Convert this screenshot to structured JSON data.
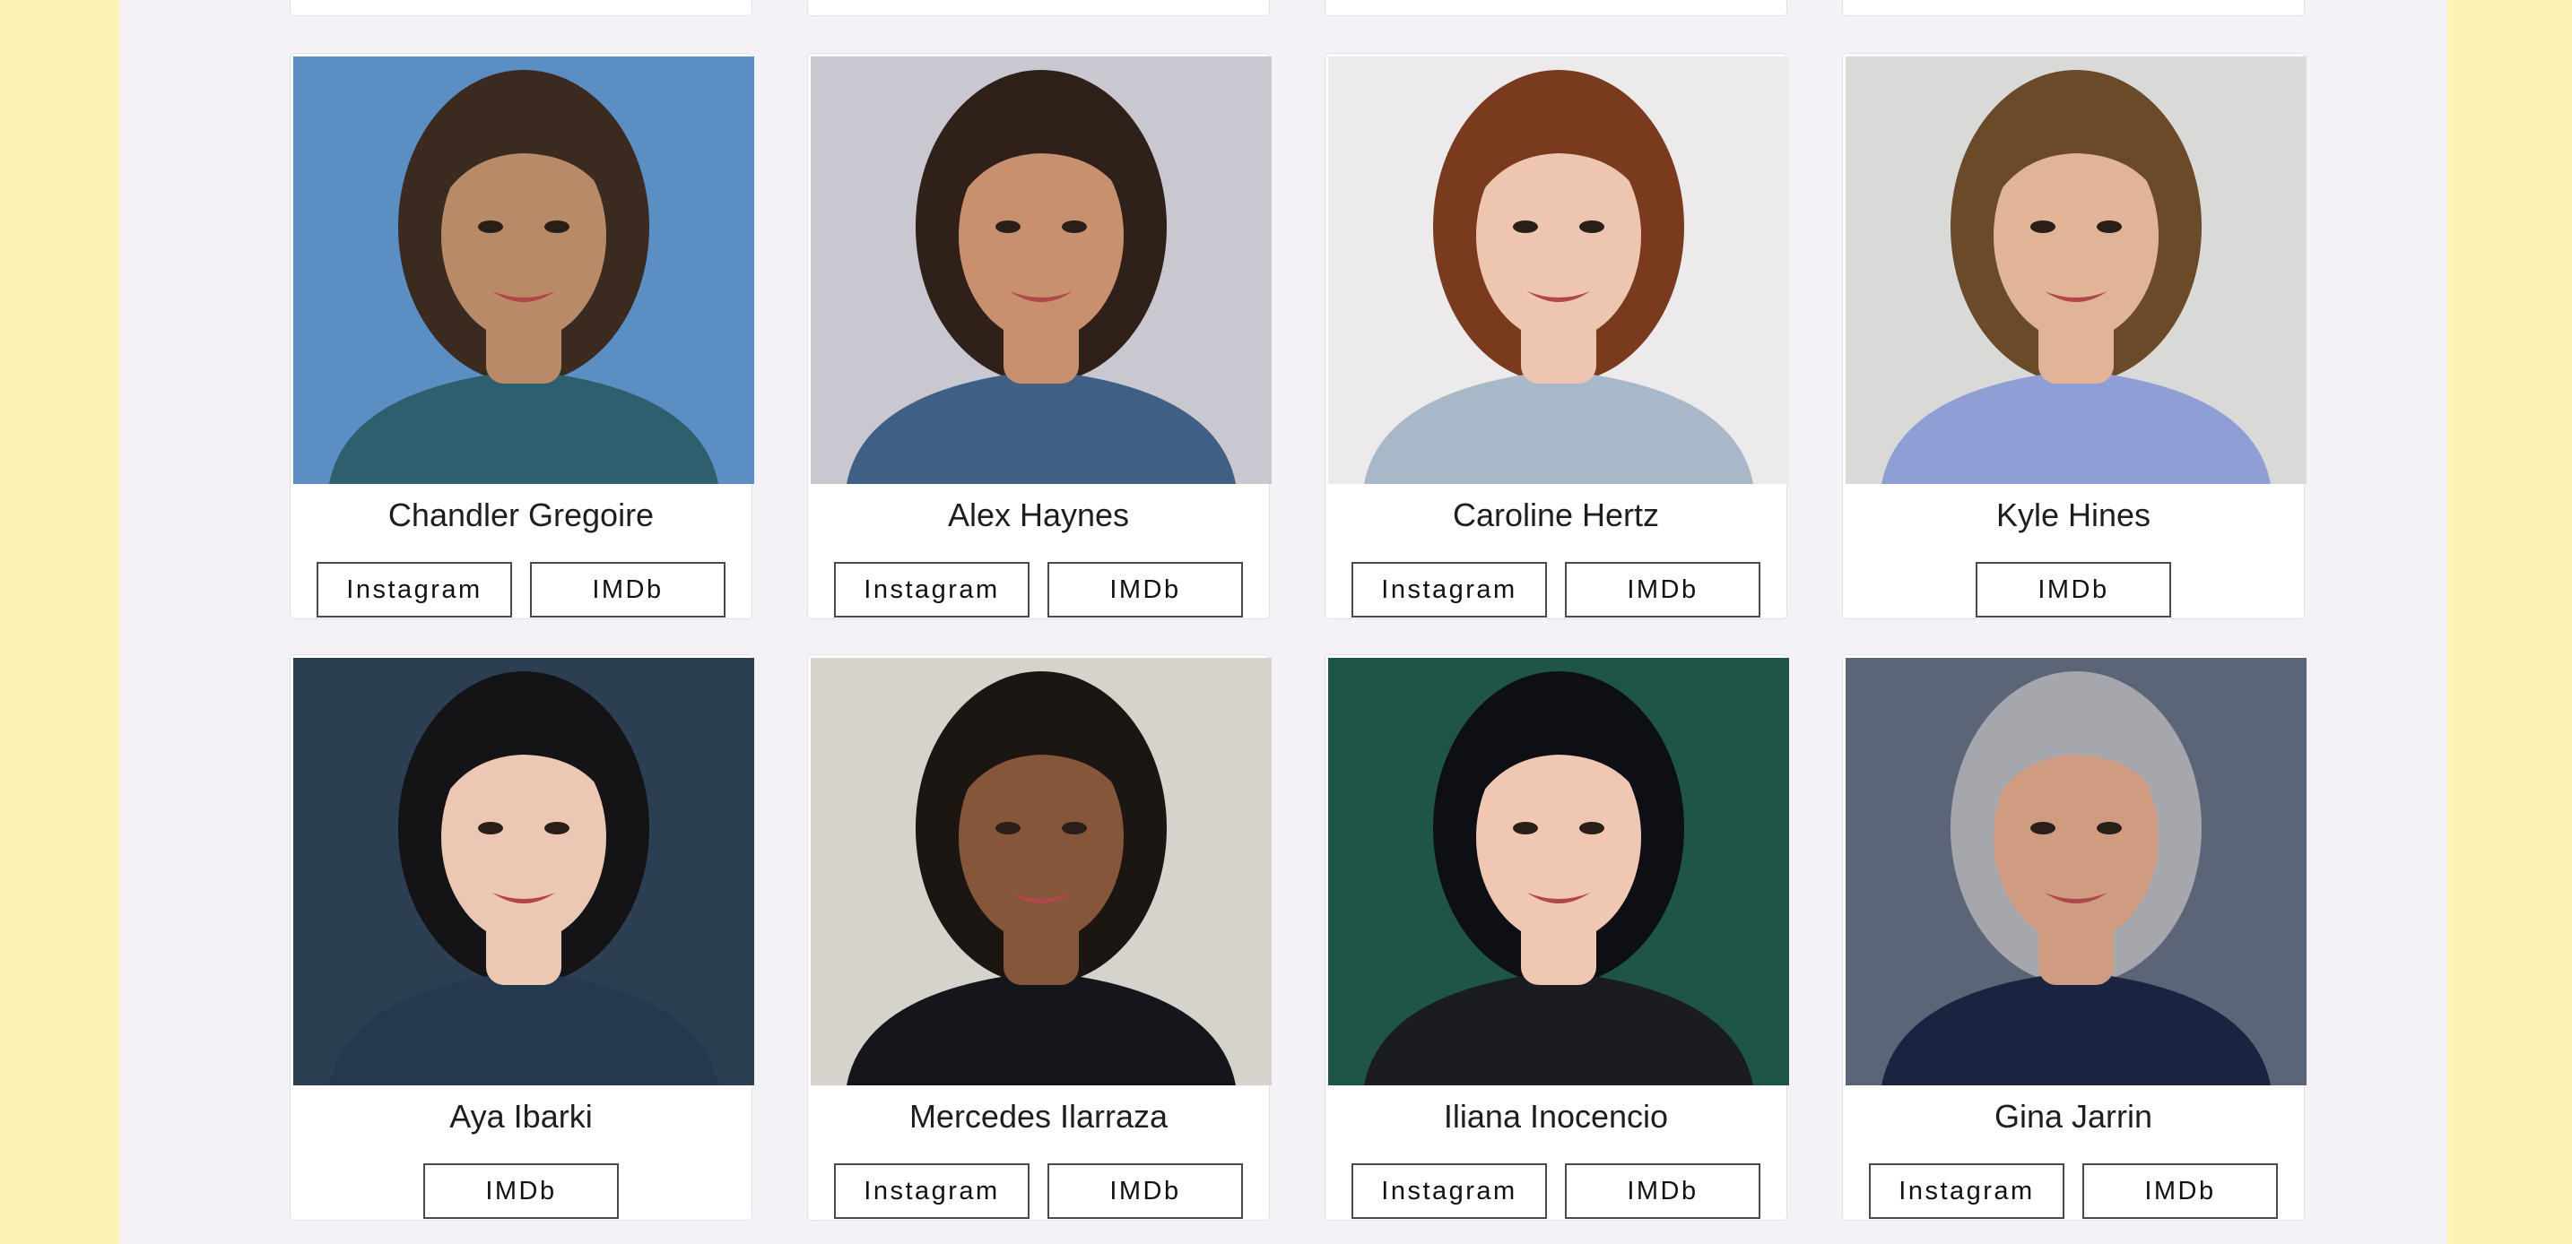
{
  "actors": [
    {
      "name": "Chandler Gregoire",
      "buttons": [
        "Instagram",
        "IMDb"
      ],
      "bg": "#5b8fc4",
      "hair": "#3a2a20",
      "skin": "#b98a68",
      "shirt": "#2e5f6e"
    },
    {
      "name": "Alex Haynes",
      "buttons": [
        "Instagram",
        "IMDb"
      ],
      "bg": "#c9c7d0",
      "hair": "#2f2119",
      "skin": "#c8906f",
      "shirt": "#3f5f85"
    },
    {
      "name": "Caroline Hertz",
      "buttons": [
        "Instagram",
        "IMDb"
      ],
      "bg": "#eceaea",
      "hair": "#7a3a1e",
      "skin": "#eec5b1",
      "shirt": "#a9b8c8"
    },
    {
      "name": "Kyle Hines",
      "buttons": [
        "IMDb"
      ],
      "bg": "#d9d9d8",
      "hair": "#6b4a2a",
      "skin": "#e2b497",
      "shirt": "#8f9fd6"
    },
    {
      "name": "Aya Ibarki",
      "buttons": [
        "IMDb"
      ],
      "bg": "#2c3f52",
      "hair": "#141416",
      "skin": "#ecc7b3",
      "shirt": "#25384f"
    },
    {
      "name": "Mercedes Ilarraza",
      "buttons": [
        "Instagram",
        "IMDb"
      ],
      "bg": "#d6d2cc",
      "hair": "#1c1612",
      "skin": "#86563b",
      "shirt": "#15151c"
    },
    {
      "name": "Iliana Inocencio",
      "buttons": [
        "Instagram",
        "IMDb"
      ],
      "bg": "#1f5448",
      "hair": "#0e0f14",
      "skin": "#f0c7b3",
      "shirt": "#1b1b22"
    },
    {
      "name": "Gina Jarrin",
      "buttons": [
        "Instagram",
        "IMDb"
      ],
      "bg": "#5c6478",
      "hair": "#a6a7ad",
      "skin": "#cf9c82",
      "shirt": "#1a2340"
    }
  ]
}
